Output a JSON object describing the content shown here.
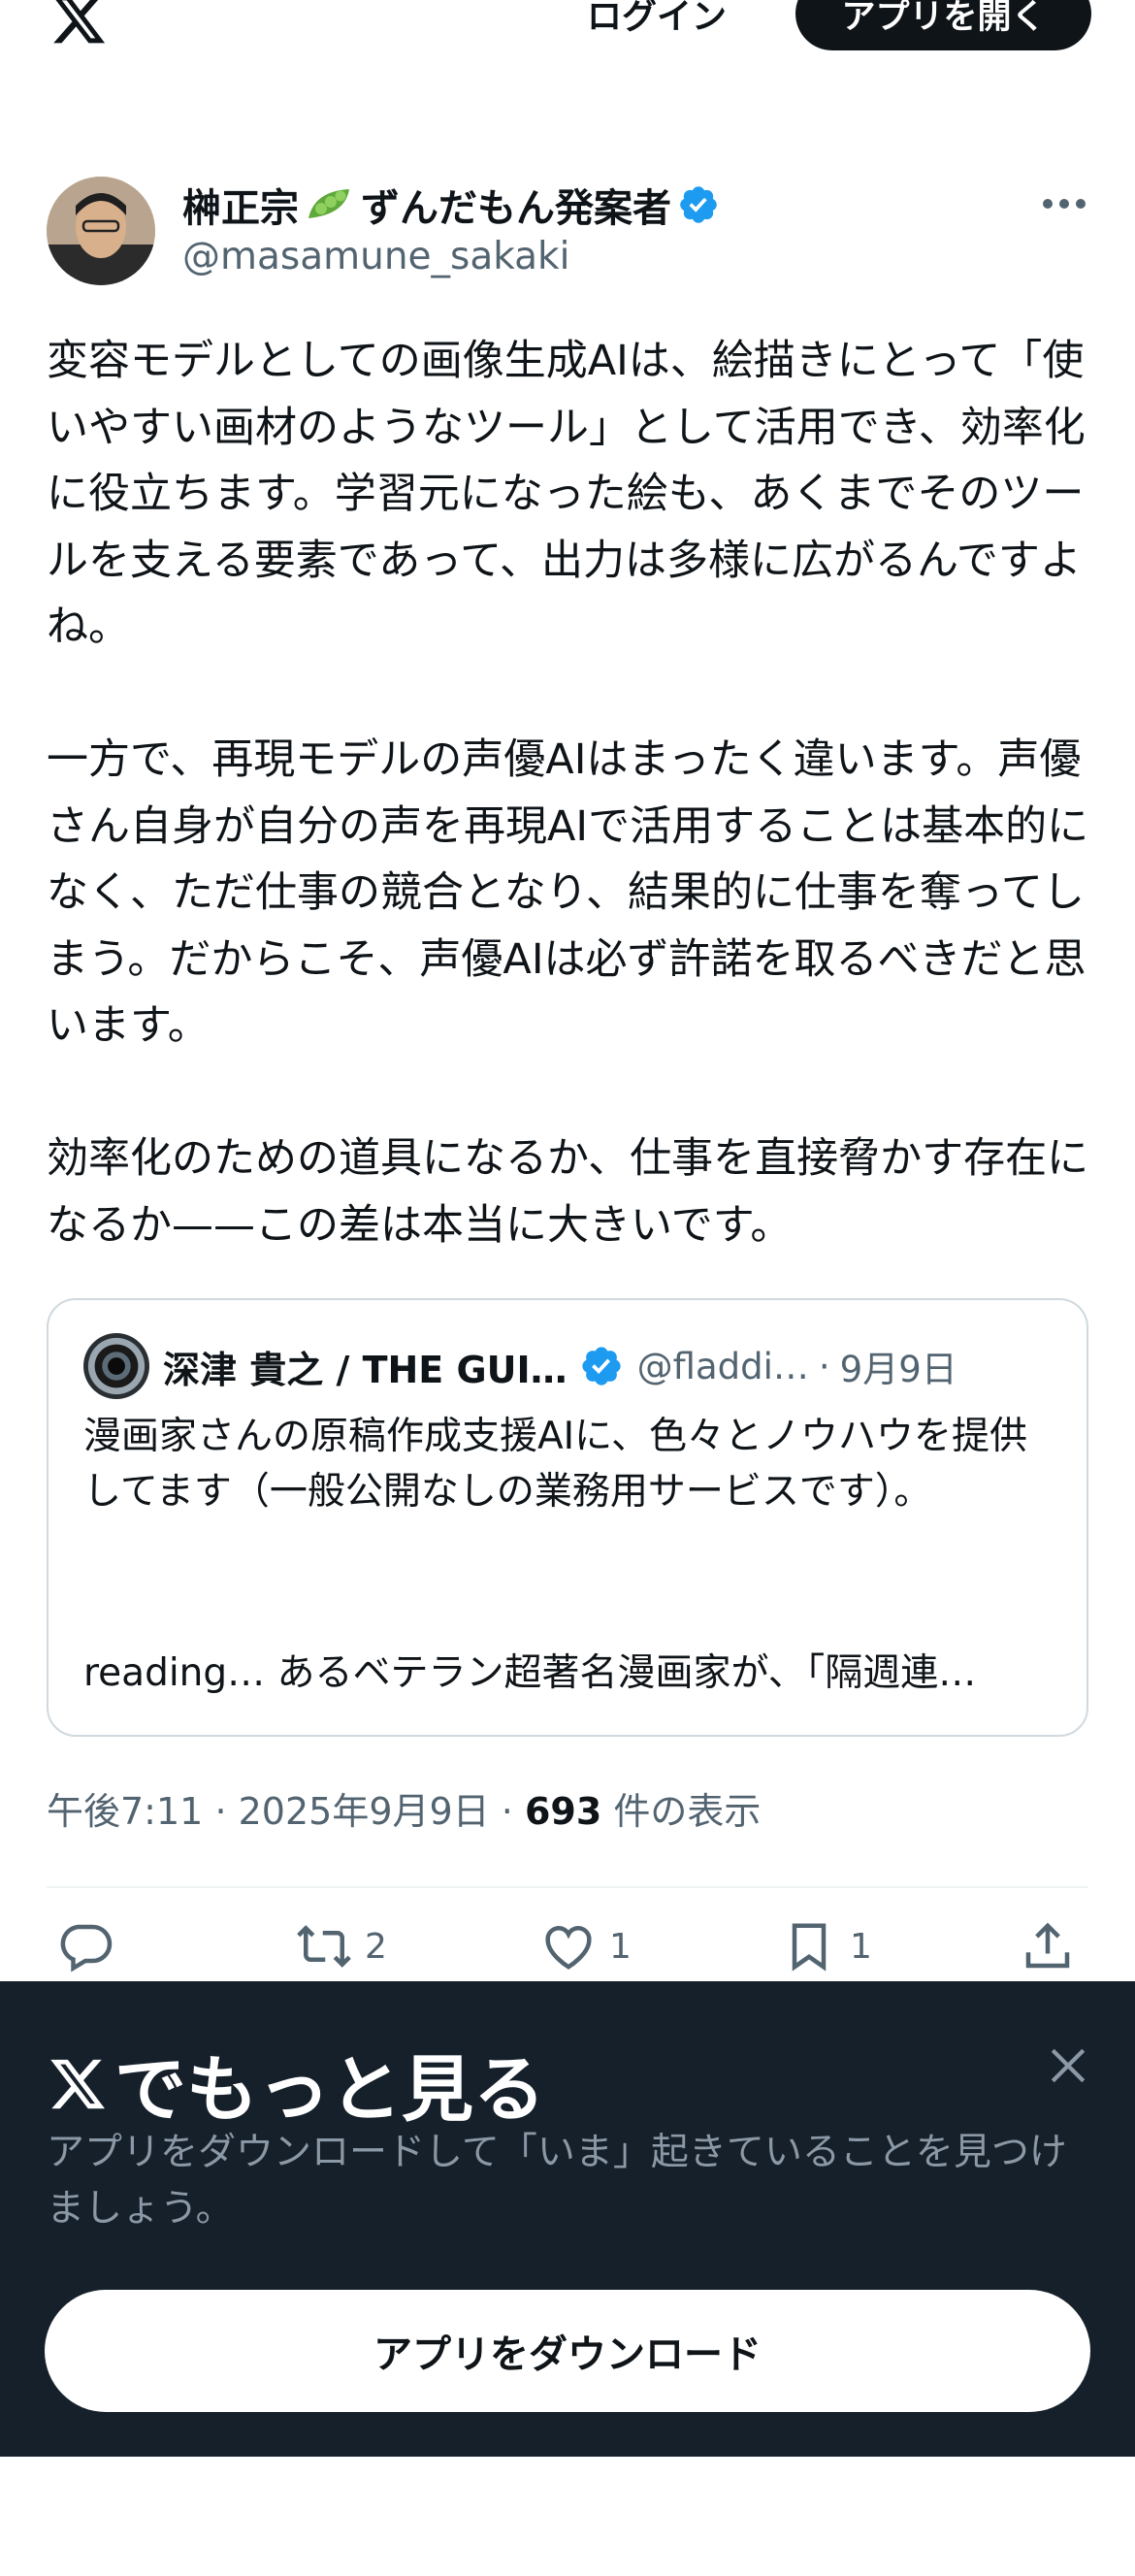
{
  "header": {
    "logo_icon": "x-logo-icon",
    "login_label": "ログイン",
    "open_app_label": "アプリを開く"
  },
  "tweet": {
    "author_name": "榊正宗",
    "author_name_suffix": "ずんだもん発案者",
    "author_emoji_icon": "edamame-icon",
    "verified_icon": "verified-badge-icon",
    "verified_color": "#1d9bf0",
    "handle": "@masamune_sakaki",
    "more_icon": "more-icon",
    "text": "変容モデルとしての画像生成AIは、絵描きにとって「使いやすい画材のようなツール」として活用でき、効率化に役立ちます。学習元になった絵も、あくまでそのツールを支える要素であって、出力は多様に広がるんですよね。\n\n一方で、再現モデルの声優AIはまったく違います。声優さん自身が自分の声を再現AIで活用することは基本的になく、ただ仕事の競合となり、結果的に仕事を奪ってしまう。だからこそ、声優AIは必ず許諾を取るべきだと思います。\n\n効率化のための道具になるか、仕事を直接脅かす存在になるか——この差は本当に大きいです。",
    "quote": {
      "author_name": "深津 貴之 / THE GUI…",
      "handle": "@fladdi…",
      "date": "9月9日",
      "text": "漫画家さんの原稿作成支援AIに、色々とノウハウを提供してます（一般公開なしの業務用サービスです）。",
      "reading": "reading… あるベテラン超著名漫画家が、「隔週連…"
    },
    "time": "午後7:11",
    "date": "2025年9月9日",
    "views_count": "693",
    "views_label": "件の表示",
    "actions": {
      "reply_icon": "reply-icon",
      "retweet_icon": "retweet-icon",
      "retweet_count": "2",
      "like_icon": "heart-icon",
      "like_count": "1",
      "bookmark_icon": "bookmark-icon",
      "bookmark_count": "1",
      "share_icon": "share-icon"
    }
  },
  "banner": {
    "title": "でもっと見る",
    "close_icon": "close-icon",
    "subtitle": "アプリをダウンロードして「いま」起きていることを見つけましょう。",
    "download_label": "アプリをダウンロード"
  }
}
